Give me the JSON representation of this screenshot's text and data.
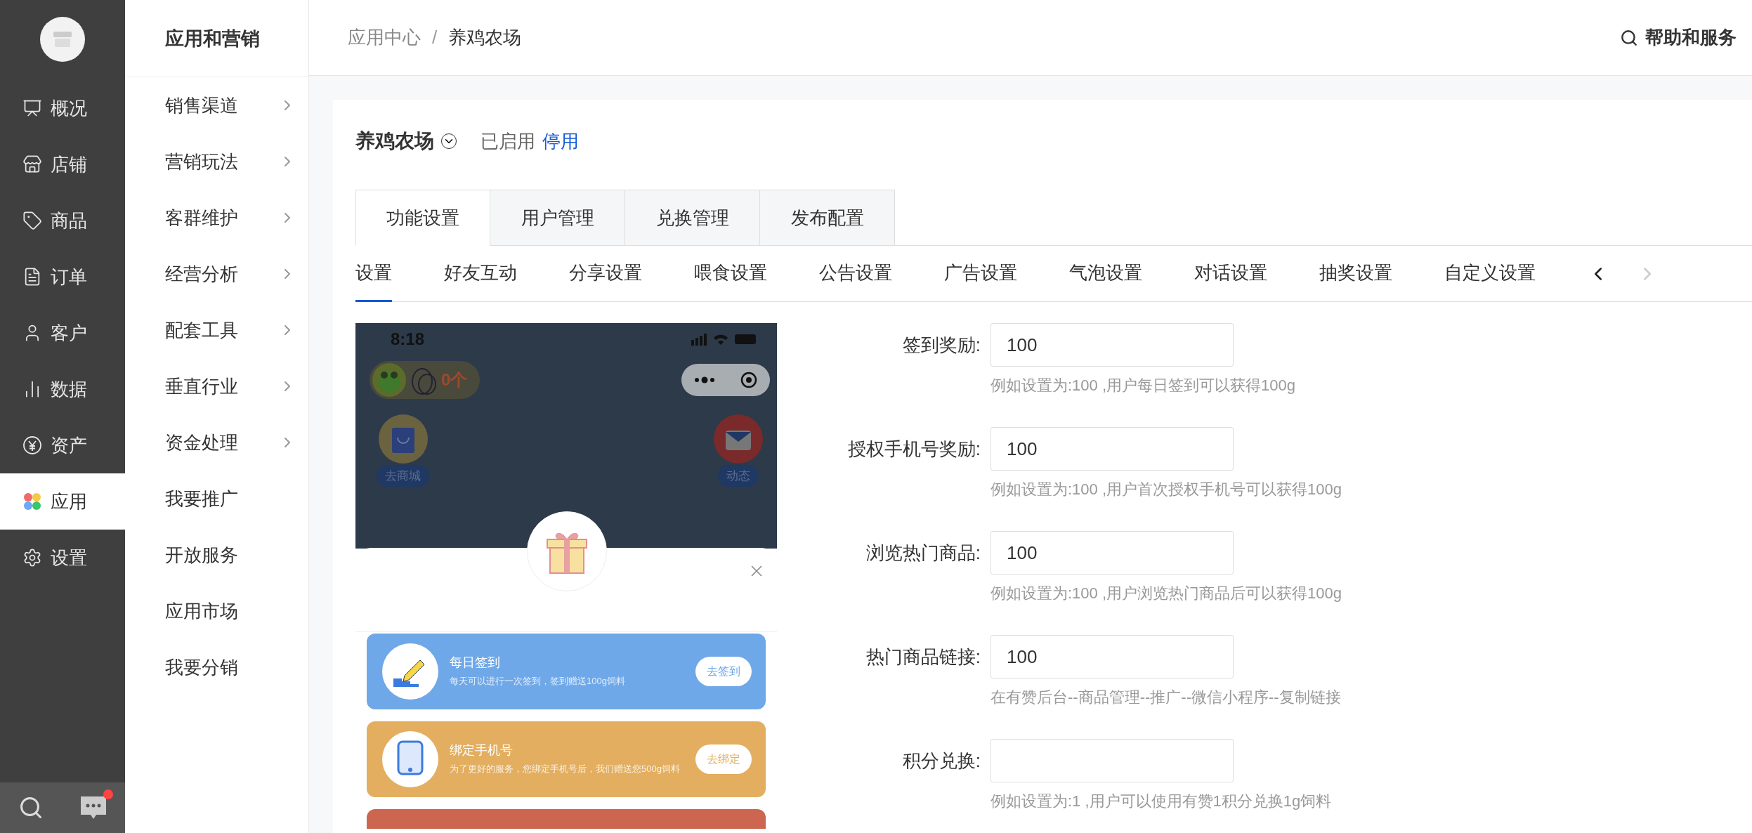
{
  "nav": {
    "items": [
      {
        "label": "概况",
        "selected": false
      },
      {
        "label": "店铺",
        "selected": false
      },
      {
        "label": "商品",
        "selected": false
      },
      {
        "label": "订单",
        "selected": false
      },
      {
        "label": "客户",
        "selected": false
      },
      {
        "label": "数据",
        "selected": false
      },
      {
        "label": "资产",
        "selected": false
      },
      {
        "label": "应用",
        "selected": true
      },
      {
        "label": "设置",
        "selected": false
      }
    ],
    "chat_unread": true
  },
  "submenu": {
    "title": "应用和营销",
    "items": [
      {
        "label": "销售渠道",
        "has_children": true
      },
      {
        "label": "营销玩法",
        "has_children": true
      },
      {
        "label": "客群维护",
        "has_children": true
      },
      {
        "label": "经营分析",
        "has_children": true
      },
      {
        "label": "配套工具",
        "has_children": true
      },
      {
        "label": "垂直行业",
        "has_children": true
      },
      {
        "label": "资金处理",
        "has_children": true
      },
      {
        "label": "我要推广",
        "has_children": false
      },
      {
        "label": "开放服务",
        "has_children": false
      },
      {
        "label": "应用市场",
        "has_children": false
      },
      {
        "label": "我要分销",
        "has_children": false
      }
    ]
  },
  "breadcrumb": [
    "应用中心",
    "养鸡农场"
  ],
  "breadcrumb_separator": "/",
  "help": "帮助和服务",
  "app": {
    "name": "养鸡农场",
    "status": "已启用",
    "action": "停用"
  },
  "tabs": [
    {
      "label": "功能设置",
      "selected": true
    },
    {
      "label": "用户管理",
      "selected": false
    },
    {
      "label": "兑换管理",
      "selected": false
    },
    {
      "label": "发布配置",
      "selected": false
    }
  ],
  "subtabs": [
    {
      "label": "设置",
      "selected": true
    },
    {
      "label": "好友互动",
      "selected": false
    },
    {
      "label": "分享设置",
      "selected": false
    },
    {
      "label": "喂食设置",
      "selected": false
    },
    {
      "label": "公告设置",
      "selected": false
    },
    {
      "label": "广告设置",
      "selected": false
    },
    {
      "label": "气泡设置",
      "selected": false
    },
    {
      "label": "对话设置",
      "selected": false
    },
    {
      "label": "抽奖设置",
      "selected": false
    },
    {
      "label": "自定义设置",
      "selected": false
    }
  ],
  "subtab_nav": {
    "prev_disabled": false,
    "next_disabled": true
  },
  "phone": {
    "time": "8:18",
    "egg_count": "0个",
    "left_button": "去商城",
    "right_button": "动态",
    "tasks": [
      {
        "title": "每日签到",
        "description": "每天可以进行一次签到，签到赠送100g饲料",
        "action": "去签到",
        "color": "#6fa8e8"
      },
      {
        "title": "绑定手机号",
        "description": "为了更好的服务，您绑定手机号后，我们赠送您500g饲料",
        "action": "去绑定",
        "color": "#e3ae5f"
      },
      {
        "color": "#cc6650"
      }
    ]
  },
  "form": {
    "fields": [
      {
        "label": "签到奖励:",
        "value": "100",
        "hint": "例如设置为:100 ,用户每日签到可以获得100g"
      },
      {
        "label": "授权手机号奖励:",
        "value": "100",
        "hint": "例如设置为:100 ,用户首次授权手机号可以获得100g"
      },
      {
        "label": "浏览热门商品:",
        "value": "100",
        "hint": "例如设置为:100 ,用户浏览热门商品后可以获得100g"
      },
      {
        "label": "热门商品链接:",
        "value": "100",
        "hint": "在有赞后台--商品管理--推广--微信小程序--复制链接"
      },
      {
        "label": "积分兑换:",
        "hint": "例如设置为:1 ,用户可以使用有赞1积分兑换1g饲料"
      }
    ]
  }
}
